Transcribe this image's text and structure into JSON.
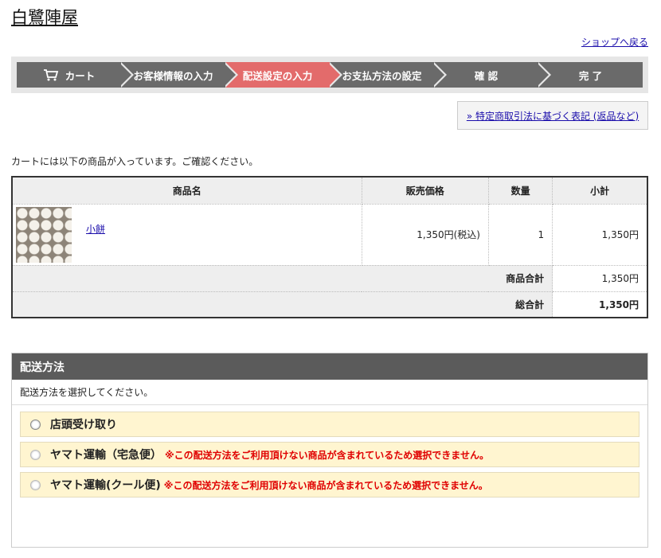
{
  "header": {
    "shop_name": "白鷺陣屋",
    "back_link": "ショップへ戻る"
  },
  "steps": [
    {
      "label": "カート",
      "icon": "cart-icon"
    },
    {
      "label": "お客様情報の入力"
    },
    {
      "label": "配送設定の入力",
      "active": true
    },
    {
      "label": "お支払方法の設定"
    },
    {
      "label": "確 認"
    },
    {
      "label": "完 了"
    }
  ],
  "legal_link": "» 特定商取引法に基づく表記 (返品など)",
  "intro": "カートには以下の商品が入っています。ご確認ください。",
  "cart": {
    "headers": {
      "product": "商品名",
      "price": "販売価格",
      "qty": "数量",
      "subtotal": "小計"
    },
    "items": [
      {
        "name": "小餅",
        "price": "1,350円(税込)",
        "qty": "1",
        "subtotal": "1,350円"
      }
    ],
    "product_total_label": "商品合計",
    "product_total": "1,350円",
    "grand_total_label": "総合計",
    "grand_total": "1,350円"
  },
  "delivery": {
    "title": "配送方法",
    "note": "配送方法を選択してください。",
    "options": [
      {
        "label": "店頭受け取り",
        "warning": ""
      },
      {
        "label": "ヤマト運輸（宅急便）",
        "warning": "※この配送方法をご利用頂けない商品が含まれているため選択できません。"
      },
      {
        "label": "ヤマト運輸(クール便)",
        "warning": "※この配送方法をご利用頂けない商品が含まれているため選択できません。"
      }
    ]
  },
  "colors": {
    "active_step": "#e36b6b",
    "step_bg": "#6a6a6a",
    "warning": "#e00000",
    "option_bg": "#fff5d0"
  }
}
